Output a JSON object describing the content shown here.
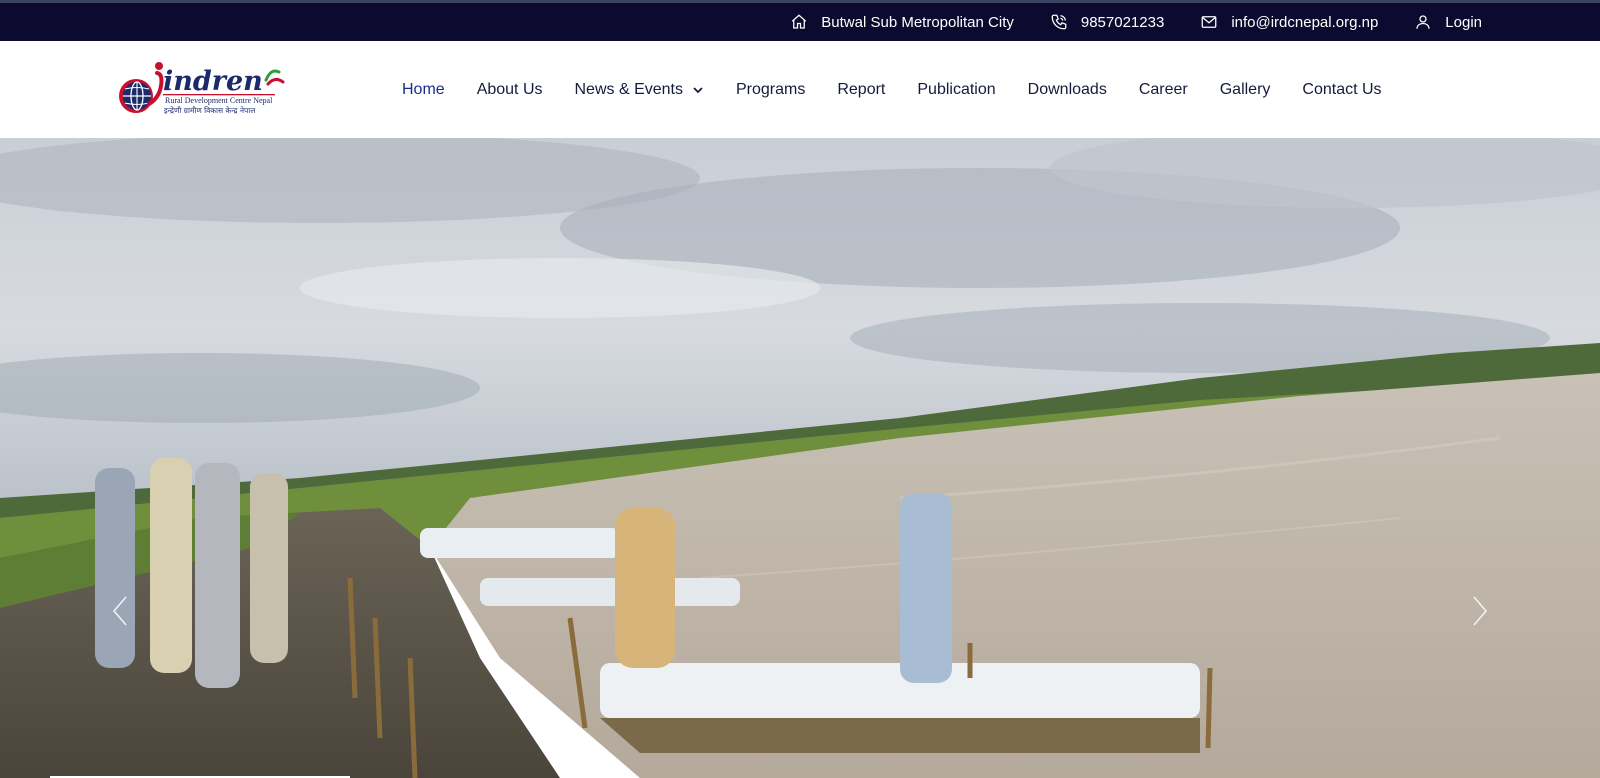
{
  "topbar": {
    "location": "Butwal Sub Metropolitan City",
    "phone": "9857021233",
    "email": "info@irdcnepal.org.np",
    "login": "Login"
  },
  "logo": {
    "brand": "indren",
    "tagline": "Rural Development Centre Nepal",
    "tagline_np": "इन्द्रेणी ग्रामीण विकास केन्द्र नेपाल"
  },
  "nav": {
    "items": [
      {
        "label": "Home",
        "active": true
      },
      {
        "label": "About Us"
      },
      {
        "label": "News & Events",
        "dropdown": true
      },
      {
        "label": "Programs"
      },
      {
        "label": "Report"
      },
      {
        "label": "Publication"
      },
      {
        "label": "Downloads"
      },
      {
        "label": "Career"
      },
      {
        "label": "Gallery"
      },
      {
        "label": "Contact Us"
      }
    ]
  },
  "hero": {
    "image": "riverbank-sandbag-embankment-photo",
    "prev_icon": "chevron-left-icon",
    "next_icon": "chevron-right-icon"
  },
  "colors": {
    "topbar_bg": "#0c0a2e",
    "nav_text": "#141c3a",
    "nav_active": "#1a2b8c",
    "brand_red": "#c8102e",
    "brand_navy": "#1b2a6b"
  }
}
